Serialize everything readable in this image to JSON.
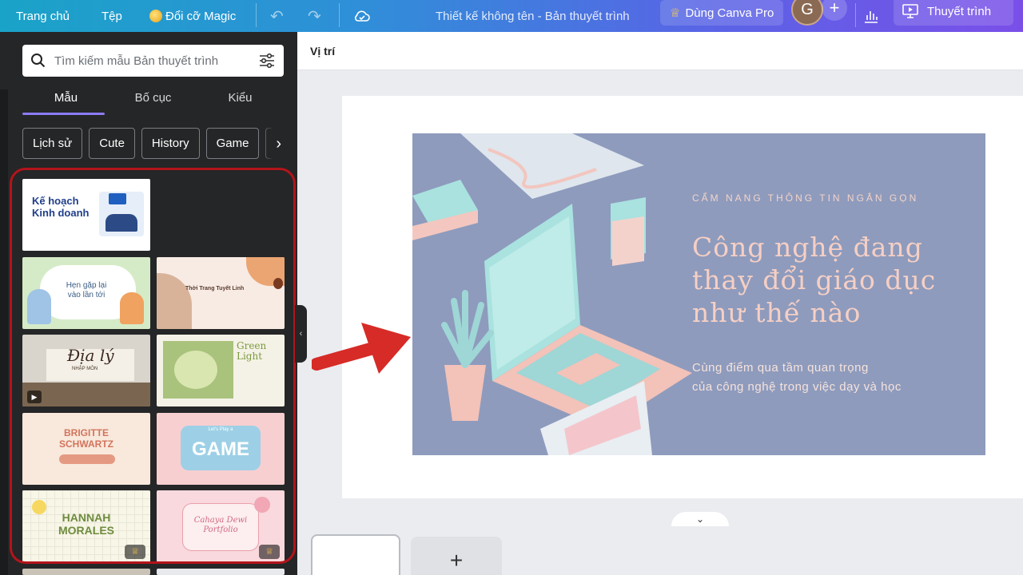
{
  "topbar": {
    "home": "Trang chủ",
    "file": "Tệp",
    "magic": "Đổi cỡ Magic",
    "doc_title": "Thiết kế không tên - Bản thuyết trình",
    "pro": "Dùng Canva Pro",
    "avatar_initial": "G",
    "present": "Thuyết trình"
  },
  "panel": {
    "search_placeholder": "Tìm kiếm mẫu Bản thuyết trình",
    "tabs": [
      "Mẫu",
      "Bố cục",
      "Kiểu"
    ],
    "active_tab": "Mẫu",
    "chips": [
      "Lịch sử",
      "Cute",
      "History",
      "Game",
      "T"
    ]
  },
  "templates": [
    {
      "line1": "Kế hoạch",
      "line2": "Kinh doanh"
    },
    {
      "line1": "Hẹn gặp lại",
      "line2": "vào lần tới"
    },
    {
      "line1": "Thời Trang Tuyết Linh"
    },
    {
      "line1": "Địa lý",
      "line2": "NHẬP MÔN"
    },
    {
      "line1": "Green",
      "line2": "Light"
    },
    {
      "line1": "BRIGITTE",
      "line2": "SCHWARTZ"
    },
    {
      "line1": "Let's Play a",
      "line2": "GAME"
    },
    {
      "line1": "HANNAH",
      "line2": "MORALES"
    },
    {
      "line1": "Cahaya Dewi",
      "line2": "Portfolio"
    }
  ],
  "editor": {
    "toolbar_position": "Vị trí",
    "slide_kicker": "CẨM NANG THÔNG TIN NGẮN GỌN",
    "slide_title": "Công nghệ đang thay đổi giáo dục như thế nào",
    "slide_subtitle_1": "Cùng điểm qua tầm quan trọng",
    "slide_subtitle_2": "của công nghệ trong việc dạy và học",
    "add_page": "+"
  },
  "colors": {
    "accent": "#8b7cf6",
    "highlight": "#b3141b",
    "arrow": "#d62b27",
    "slide_bg": "#8e9bbd"
  }
}
